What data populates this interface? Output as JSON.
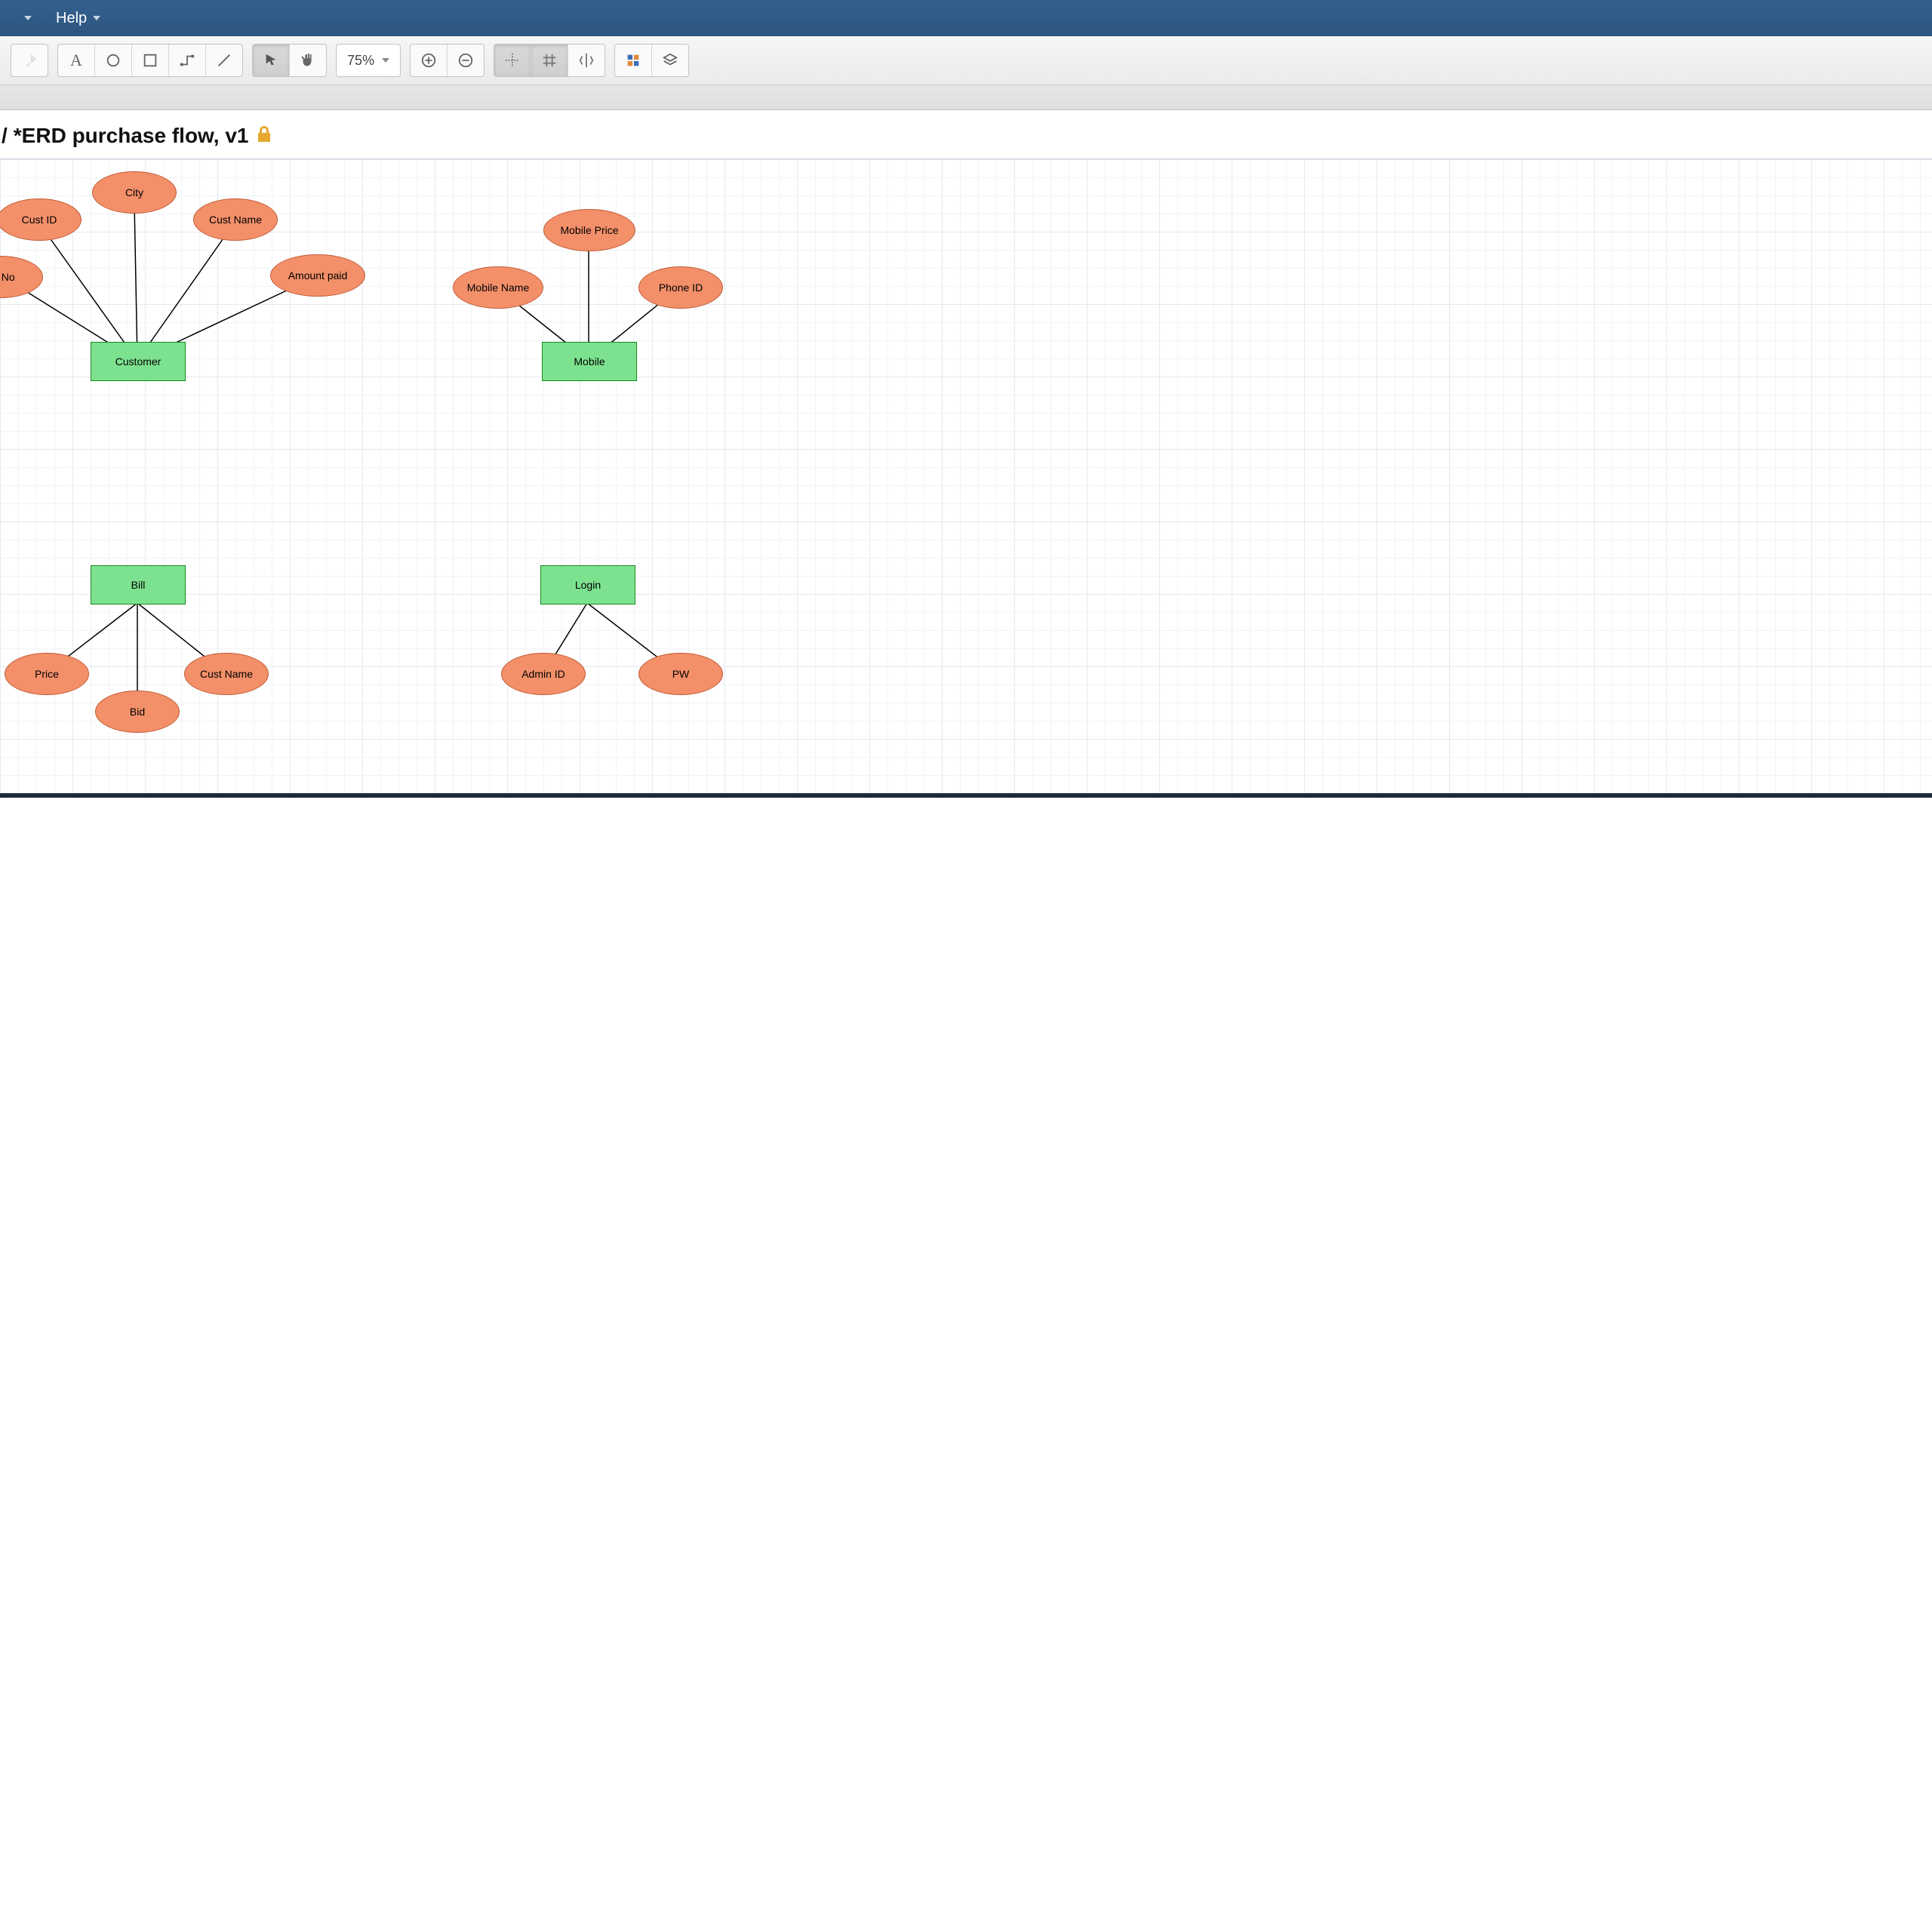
{
  "menubar": {
    "help": "Help"
  },
  "toolbar": {
    "zoom": "75%"
  },
  "document": {
    "prefix": "/",
    "title": "*ERD purchase flow, v1"
  },
  "diagram": {
    "entities": {
      "customer": "Customer",
      "mobile": "Mobile",
      "bill": "Bill",
      "login": "Login"
    },
    "attributes": {
      "phone_no": "ne No",
      "cust_id": "Cust ID",
      "city": "City",
      "cust_name": "Cust Name",
      "amount_paid": "Amount paid",
      "mobile_name": "Mobile Name",
      "mobile_price": "Mobile Price",
      "phone_id": "Phone ID",
      "price": "Price",
      "bid": "Bid",
      "bill_cust": "Cust Name",
      "admin_id": "Admin ID",
      "pw": "PW"
    }
  },
  "chart_data": {
    "type": "er-diagram",
    "entities": [
      {
        "name": "Customer",
        "attributes": [
          "Phone No",
          "Cust ID",
          "City",
          "Cust Name",
          "Amount paid"
        ]
      },
      {
        "name": "Mobile",
        "attributes": [
          "Mobile Name",
          "Mobile Price",
          "Phone ID"
        ]
      },
      {
        "name": "Bill",
        "attributes": [
          "Price",
          "Bid",
          "Cust Name"
        ]
      },
      {
        "name": "Login",
        "attributes": [
          "Admin ID",
          "PW"
        ]
      }
    ]
  }
}
